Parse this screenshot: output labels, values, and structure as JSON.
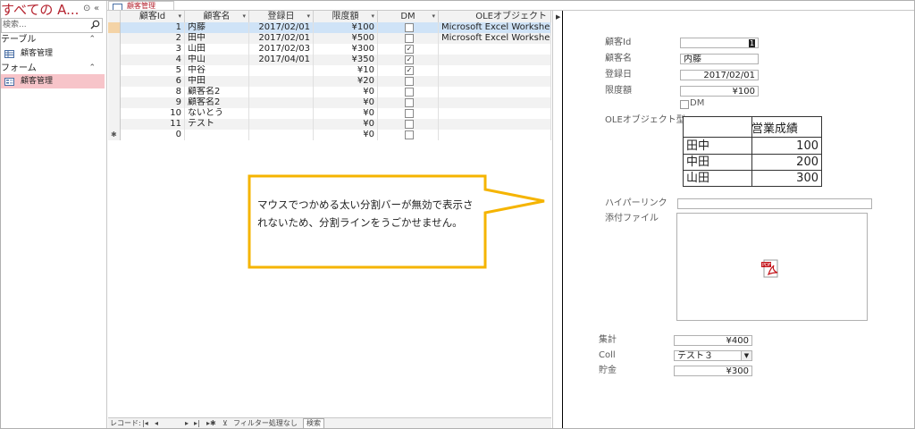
{
  "nav": {
    "title": "すべての A...",
    "search_placeholder": "検索...",
    "groups": [
      {
        "label": "テーブル",
        "items": [
          {
            "label": "顧客管理"
          }
        ]
      },
      {
        "label": "フォーム",
        "items": [
          {
            "label": "顧客管理"
          }
        ]
      }
    ]
  },
  "tab": {
    "label": "顧客管理"
  },
  "sheet": {
    "columns": [
      "顧客Id",
      "顧客名",
      "登録日",
      "限度額",
      "DM",
      "OLEオブジェクト"
    ],
    "rows": [
      {
        "id": "1",
        "name": "内藤",
        "date": "2017/02/01",
        "limit": "¥100",
        "dm": false,
        "ole": "Microsoft Excel Workshee"
      },
      {
        "id": "2",
        "name": "田中",
        "date": "2017/02/01",
        "limit": "¥500",
        "dm": false,
        "ole": "Microsoft Excel Workshee"
      },
      {
        "id": "3",
        "name": "山田",
        "date": "2017/02/03",
        "limit": "¥300",
        "dm": true,
        "ole": ""
      },
      {
        "id": "4",
        "name": "中山",
        "date": "2017/04/01",
        "limit": "¥350",
        "dm": true,
        "ole": ""
      },
      {
        "id": "5",
        "name": "中谷",
        "date": "",
        "limit": "¥10",
        "dm": true,
        "ole": ""
      },
      {
        "id": "6",
        "name": "中田",
        "date": "",
        "limit": "¥20",
        "dm": false,
        "ole": ""
      },
      {
        "id": "8",
        "name": "顧客名2",
        "date": "",
        "limit": "¥0",
        "dm": false,
        "ole": ""
      },
      {
        "id": "9",
        "name": "顧客名2",
        "date": "",
        "limit": "¥0",
        "dm": false,
        "ole": ""
      },
      {
        "id": "10",
        "name": "ないとう",
        "date": "",
        "limit": "¥0",
        "dm": false,
        "ole": ""
      },
      {
        "id": "11",
        "name": "テスト",
        "date": "",
        "limit": "¥0",
        "dm": false,
        "ole": ""
      },
      {
        "id": "0",
        "name": "",
        "date": "",
        "limit": "¥0",
        "dm": false,
        "ole": ""
      }
    ],
    "new_row_marker": "✱",
    "selected_row_index": 0
  },
  "recnav": {
    "record_label": "レコード:",
    "filter_label": "フィルター処理なし",
    "search_label": "検索"
  },
  "form": {
    "labels": {
      "id": "顧客Id",
      "name": "顧客名",
      "date": "登録日",
      "limit": "限度額",
      "dm": "DM",
      "ole": "OLEオブジェクト型",
      "hyperlink": "ハイパーリンク",
      "attach": "添付ファイル",
      "total": "集計",
      "coll": "Coll",
      "savings": "貯金"
    },
    "values": {
      "id": "1",
      "name": "内藤",
      "date": "2017/02/01",
      "limit": "¥100",
      "total": "¥400",
      "coll": "テスト３",
      "savings": "¥300"
    },
    "ole_table": {
      "header": "営業成績",
      "rows": [
        [
          "田中",
          "100"
        ],
        [
          "中田",
          "200"
        ],
        [
          "山田",
          "300"
        ]
      ]
    }
  },
  "callout": {
    "text": "マウスでつかめる太い分割バーが無効で表示されないため、分割ラインをうごかせません。",
    "border_color": "#f5b400"
  },
  "colors": {
    "accent": "#b5232f",
    "selection": "#cfe3f7",
    "nav_selected": "#f7c4c9"
  }
}
